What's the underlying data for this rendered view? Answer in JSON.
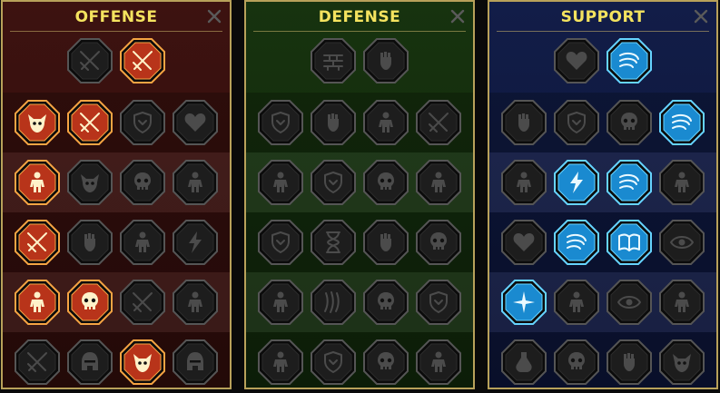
{
  "panels": [
    {
      "id": "offense",
      "title": "OFFENSE",
      "top_icons": [
        {
          "name": "crossed-swords-icon",
          "state": "inactive"
        },
        {
          "name": "sword-strike-icon",
          "state": "active"
        }
      ],
      "rows": [
        [
          {
            "name": "demon-rage-icon",
            "state": "active"
          },
          {
            "name": "blade-slash-icon",
            "state": "active"
          },
          {
            "name": "shield-break-icon",
            "state": "inactive"
          },
          {
            "name": "bleeding-heart-icon",
            "state": "inactive"
          }
        ],
        [
          {
            "name": "impaled-warrior-icon",
            "state": "active"
          },
          {
            "name": "monster-jaws-icon",
            "state": "inactive"
          },
          {
            "name": "skull-slash-icon",
            "state": "inactive"
          },
          {
            "name": "scythe-reaper-icon",
            "state": "inactive"
          }
        ],
        [
          {
            "name": "flaming-sword-icon",
            "state": "active"
          },
          {
            "name": "power-fist-icon",
            "state": "inactive"
          },
          {
            "name": "axe-swing-icon",
            "state": "inactive"
          },
          {
            "name": "chain-lightning-icon",
            "state": "inactive"
          }
        ],
        [
          {
            "name": "burst-strike-icon",
            "state": "active"
          },
          {
            "name": "toxic-skull-icon",
            "state": "active"
          },
          {
            "name": "blade-ring-icon",
            "state": "inactive"
          },
          {
            "name": "berserker-icon",
            "state": "inactive"
          }
        ],
        [
          {
            "name": "sword-rain-icon",
            "state": "inactive"
          },
          {
            "name": "knight-helm-icon",
            "state": "inactive"
          },
          {
            "name": "fire-demon-icon",
            "state": "active"
          },
          {
            "name": "spiked-helm-icon",
            "state": "inactive"
          }
        ]
      ]
    },
    {
      "id": "defense",
      "title": "DEFENSE",
      "top_icons": [
        {
          "name": "brick-wall-icon",
          "state": "inactive"
        },
        {
          "name": "raised-fist-icon",
          "state": "inactive"
        }
      ],
      "rows": [
        [
          {
            "name": "chevron-shield-icon",
            "state": "inactive"
          },
          {
            "name": "armored-hand-icon",
            "state": "inactive"
          },
          {
            "name": "guardian-icon",
            "state": "inactive"
          },
          {
            "name": "crossed-blades-icon",
            "state": "inactive"
          }
        ],
        [
          {
            "name": "archer-icon",
            "state": "inactive"
          },
          {
            "name": "knight-shield-icon",
            "state": "inactive"
          },
          {
            "name": "skull-heart-icon",
            "state": "inactive"
          },
          {
            "name": "halo-head-icon",
            "state": "inactive"
          }
        ],
        [
          {
            "name": "shield-wall-icon",
            "state": "inactive"
          },
          {
            "name": "hourglass-icon",
            "state": "inactive"
          },
          {
            "name": "warding-hand-icon",
            "state": "inactive"
          },
          {
            "name": "bull-skull-icon",
            "state": "inactive"
          }
        ],
        [
          {
            "name": "dashing-warrior-icon",
            "state": "inactive"
          },
          {
            "name": "claw-marks-icon",
            "state": "inactive"
          },
          {
            "name": "sun-skull-icon",
            "state": "inactive"
          },
          {
            "name": "deflect-icon",
            "state": "inactive"
          }
        ],
        [
          {
            "name": "golem-icon",
            "state": "inactive"
          },
          {
            "name": "layered-shield-icon",
            "state": "inactive"
          },
          {
            "name": "grim-skull-icon",
            "state": "inactive"
          },
          {
            "name": "muscle-man-icon",
            "state": "inactive"
          }
        ]
      ]
    },
    {
      "id": "support",
      "title": "SUPPORT",
      "top_icons": [
        {
          "name": "heart-plus-icon",
          "state": "inactive"
        },
        {
          "name": "spiral-wave-icon",
          "state": "active"
        }
      ],
      "rows": [
        [
          {
            "name": "praying-hands-icon",
            "state": "inactive"
          },
          {
            "name": "aura-shield-icon",
            "state": "inactive"
          },
          {
            "name": "flaming-skull-icon",
            "state": "inactive"
          },
          {
            "name": "swift-arrow-icon",
            "state": "active"
          }
        ],
        [
          {
            "name": "blessed-figure-icon",
            "state": "inactive"
          },
          {
            "name": "lightning-bolt-icon",
            "state": "active"
          },
          {
            "name": "wind-storm-icon",
            "state": "active"
          },
          {
            "name": "twin-shadows-icon",
            "state": "inactive"
          }
        ],
        [
          {
            "name": "chained-heart-icon",
            "state": "inactive"
          },
          {
            "name": "comet-icon",
            "state": "active"
          },
          {
            "name": "open-book-icon",
            "state": "active"
          },
          {
            "name": "fierce-eyes-icon",
            "state": "inactive"
          }
        ],
        [
          {
            "name": "compass-star-icon",
            "state": "active"
          },
          {
            "name": "swift-boot-icon",
            "state": "inactive"
          },
          {
            "name": "all-seeing-eye-icon",
            "state": "inactive"
          },
          {
            "name": "running-figure-icon",
            "state": "inactive"
          }
        ],
        [
          {
            "name": "potion-icon",
            "state": "inactive"
          },
          {
            "name": "death-skull-icon",
            "state": "inactive"
          },
          {
            "name": "crushing-fist-icon",
            "state": "inactive"
          },
          {
            "name": "eagle-head-icon",
            "state": "inactive"
          }
        ]
      ]
    }
  ],
  "colors": {
    "title": "#f4e35f",
    "panel_border": "#b8a15a",
    "offense_bg": "#3d1210",
    "defense_bg": "#17330f",
    "support_bg": "#121d48",
    "inactive_fill": "#1d1d1d",
    "inactive_rim": "#555555",
    "offense_active_fill": "#b8341a",
    "offense_active_rim": "#f5a443",
    "support_active_fill": "#1a8ad0",
    "support_active_rim": "#66d4ff"
  }
}
